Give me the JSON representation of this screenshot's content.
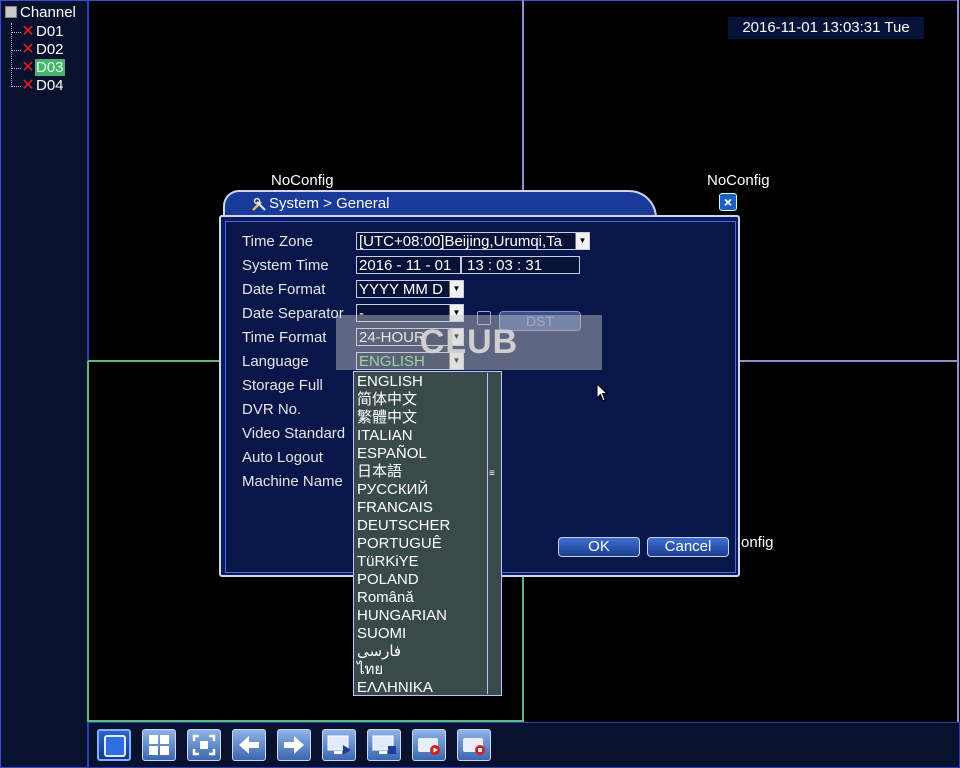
{
  "sidebar": {
    "root_label": "Channel",
    "channels": [
      {
        "label": "D01",
        "status_icon": "disconnected-x-icon",
        "selected": false
      },
      {
        "label": "D02",
        "status_icon": "disconnected-x-icon",
        "selected": false
      },
      {
        "label": "D03",
        "status_icon": "disconnected-x-icon",
        "selected": true
      },
      {
        "label": "D04",
        "status_icon": "disconnected-x-icon",
        "selected": false
      }
    ]
  },
  "overlay": {
    "timestamp": "2016-11-01 13:03:31 Tue",
    "noconfig_label": "NoConfig",
    "noconfig_partial": "onfig",
    "watermark_text": "CLUB"
  },
  "dialog": {
    "title": "System > General",
    "fields": {
      "time_zone": {
        "label": "Time Zone",
        "value": "[UTC+08:00]Beijing,Urumqi,Ta"
      },
      "system_time": {
        "label": "System Time",
        "date": "2016 - 11 - 01",
        "time": "13 : 03 : 31"
      },
      "date_format": {
        "label": "Date Format",
        "value": "YYYY MM D"
      },
      "date_separator": {
        "label": "Date Separator",
        "value": "-"
      },
      "time_format": {
        "label": "Time Format",
        "value": "24-HOUR"
      },
      "language": {
        "label": "Language",
        "value": "ENGLISH"
      },
      "storage_full": {
        "label": "Storage Full"
      },
      "dvr_no": {
        "label": "DVR No."
      },
      "video_standard": {
        "label": "Video Standard"
      },
      "auto_logout": {
        "label": "Auto Logout"
      },
      "machine_name": {
        "label": "Machine Name"
      }
    },
    "dst_label": "DST",
    "ok_label": "OK",
    "cancel_label": "Cancel"
  },
  "language_dropdown": {
    "options": [
      "ENGLISH",
      "简体中文",
      "繁體中文",
      "ITALIAN",
      "ESPAÑOL",
      "日本語",
      "РУССКИЙ",
      "FRANCAIS",
      "DEUTSCHER",
      "PORTUGUÊ",
      "TüRKiYE",
      "POLAND",
      "Românǎ",
      "HUNGARIAN",
      "SUOMI",
      "فارسی",
      "ไทย",
      "ΕΛΛΗΝΙΚΑ"
    ]
  },
  "toolbar": {
    "buttons": [
      "single-view-icon",
      "quad-view-icon",
      "fullscreen-icon",
      "previous-icon",
      "next-icon",
      "start-tour-icon",
      "stop-tour-icon",
      "record-start-icon",
      "record-stop-icon"
    ]
  },
  "colors": {
    "accent": "#3d4fd0",
    "selected_channel": "#46b46e",
    "alarm_x": "#f01c1c"
  }
}
